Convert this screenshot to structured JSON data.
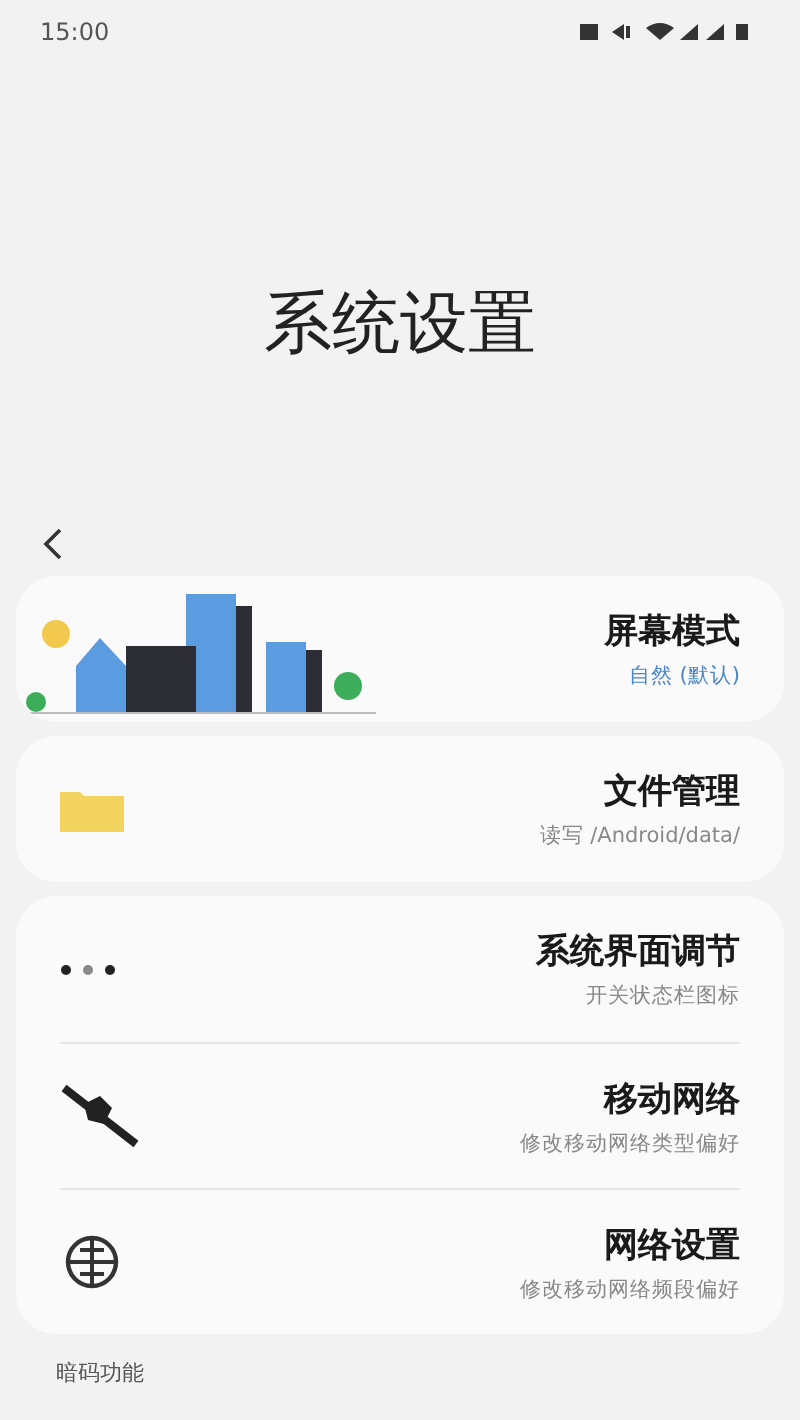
{
  "status_bar": {
    "time": "15:00"
  },
  "title": "系统设置",
  "sections": [
    {
      "items": [
        {
          "kind": "city",
          "title": "屏幕模式",
          "subtitle": "自然 (默认)",
          "accent": true
        }
      ]
    },
    {
      "items": [
        {
          "kind": "folder",
          "title": "文件管理",
          "subtitle": "读写 /Android/data/",
          "accent": false
        }
      ]
    },
    {
      "items": [
        {
          "kind": "dots",
          "title": "系统界面调节",
          "subtitle": "开关状态栏图标",
          "accent": false
        },
        {
          "kind": "network",
          "title": "移动网络",
          "subtitle": "修改移动网络类型偏好",
          "accent": false
        },
        {
          "kind": "globe",
          "title": "网络设置",
          "subtitle": "修改移动网络频段偏好",
          "accent": false
        }
      ]
    }
  ],
  "footer_label": "暗码功能"
}
